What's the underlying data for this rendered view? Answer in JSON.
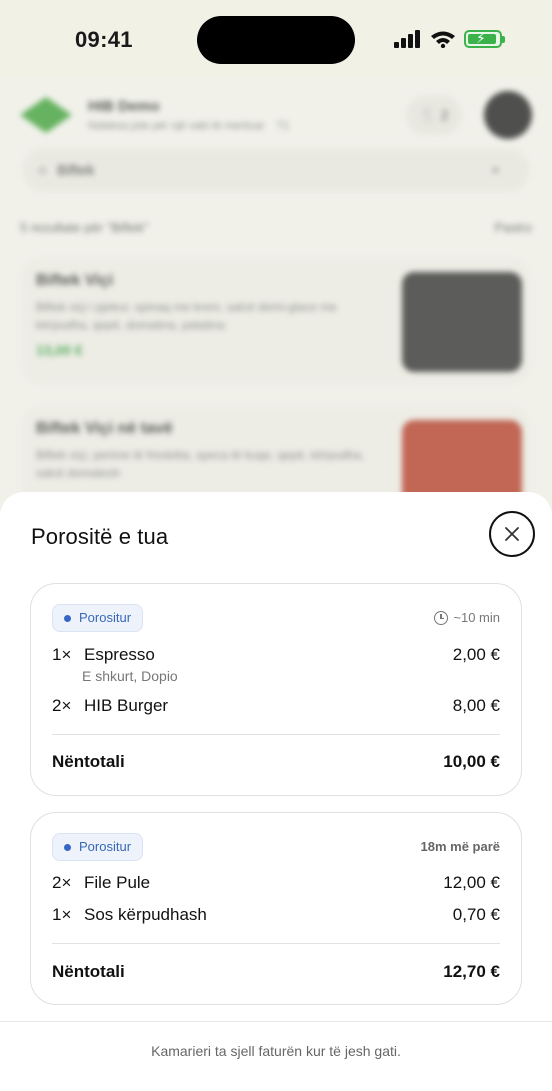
{
  "status_bar": {
    "time": "09:41"
  },
  "background": {
    "venue_name": "HIB Demo",
    "venue_subtitle": "Ndalesa jote për një vakt të merituar",
    "venue_subtitle_extra": "T1",
    "table_count": "2",
    "search_value": "Biftek",
    "results_text": "5 rezultate për \"Biftek\"",
    "clear_label": "Pastro",
    "items": [
      {
        "title": "Biftek Viçi",
        "desc": "Biftek viçi i pjekur, spinaq me krem, salcë demi-glace me kërpudha, qepë, domatina, patatina",
        "price": "13,00 €"
      },
      {
        "title": "Biftek Viçi në tavë",
        "desc": "Biftek viçi, perime të freskëta, speca të kuqe, qepë, kërpudha, salcë domatesh",
        "price": ""
      }
    ]
  },
  "sheet": {
    "title": "Porositë e tua",
    "close_icon": "close-icon",
    "orders": [
      {
        "status": "Porositur",
        "meta": "~10 min",
        "meta_icon": "clock-icon",
        "items": [
          {
            "qty": "1×",
            "name": "Espresso",
            "note": "E shkurt, Dopio",
            "price": "2,00 €"
          },
          {
            "qty": "2×",
            "name": "HIB Burger",
            "note": "",
            "price": "8,00 €"
          }
        ],
        "subtotal_label": "Nëntotali",
        "subtotal_value": "10,00 €"
      },
      {
        "status": "Porositur",
        "meta": "18m më parë",
        "items": [
          {
            "qty": "2×",
            "name": "File Pule",
            "note": "",
            "price": "12,00 €"
          },
          {
            "qty": "1×",
            "name": "Sos kërpudhash",
            "note": "",
            "price": "0,70 €"
          }
        ],
        "subtotal_label": "Nëntotali",
        "subtotal_value": "12,70 €"
      }
    ],
    "footer_text": "Kamarieri ta sjell faturën kur të jesh gati."
  },
  "colors": {
    "accent_green": "#3cb34a",
    "status_blue": "#3867b8",
    "sheet_bg": "#ffffff"
  }
}
